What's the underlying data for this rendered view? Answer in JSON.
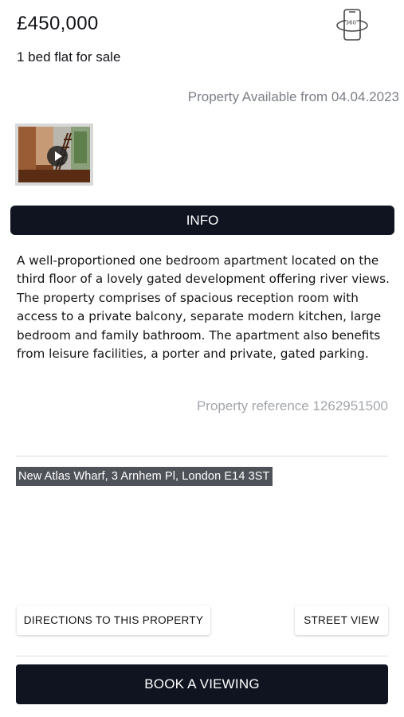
{
  "listing": {
    "price": "£450,000",
    "subtitle": "1 bed flat for sale",
    "available": "Property Available from 04.04.2023",
    "view_icon": "360-view-phone-icon"
  },
  "media": {
    "video_icon": "play-icon"
  },
  "info": {
    "tab_label": "INFO",
    "description": "A well-proportioned one bedroom apartment located on the third floor of a lovely gated development offering river views. The property comprises of spacious reception room with access to a private balcony, separate modern kitchen, large bedroom and family bathroom. The apartment also benefits from leisure facilities, a porter and private, gated parking.",
    "reference": "Property reference 1262951500"
  },
  "location": {
    "address": "New Atlas Wharf, 3 Arnhem Pl, London E14 3ST"
  },
  "actions": {
    "directions_label": "DIRECTIONS TO THIS PROPERTY",
    "street_view_label": "STREET VIEW",
    "book_label": "BOOK A VIEWING"
  },
  "colors": {
    "dark": "#0f1420",
    "muted_text": "#7b7f86",
    "address_bg": "#4f5359"
  }
}
